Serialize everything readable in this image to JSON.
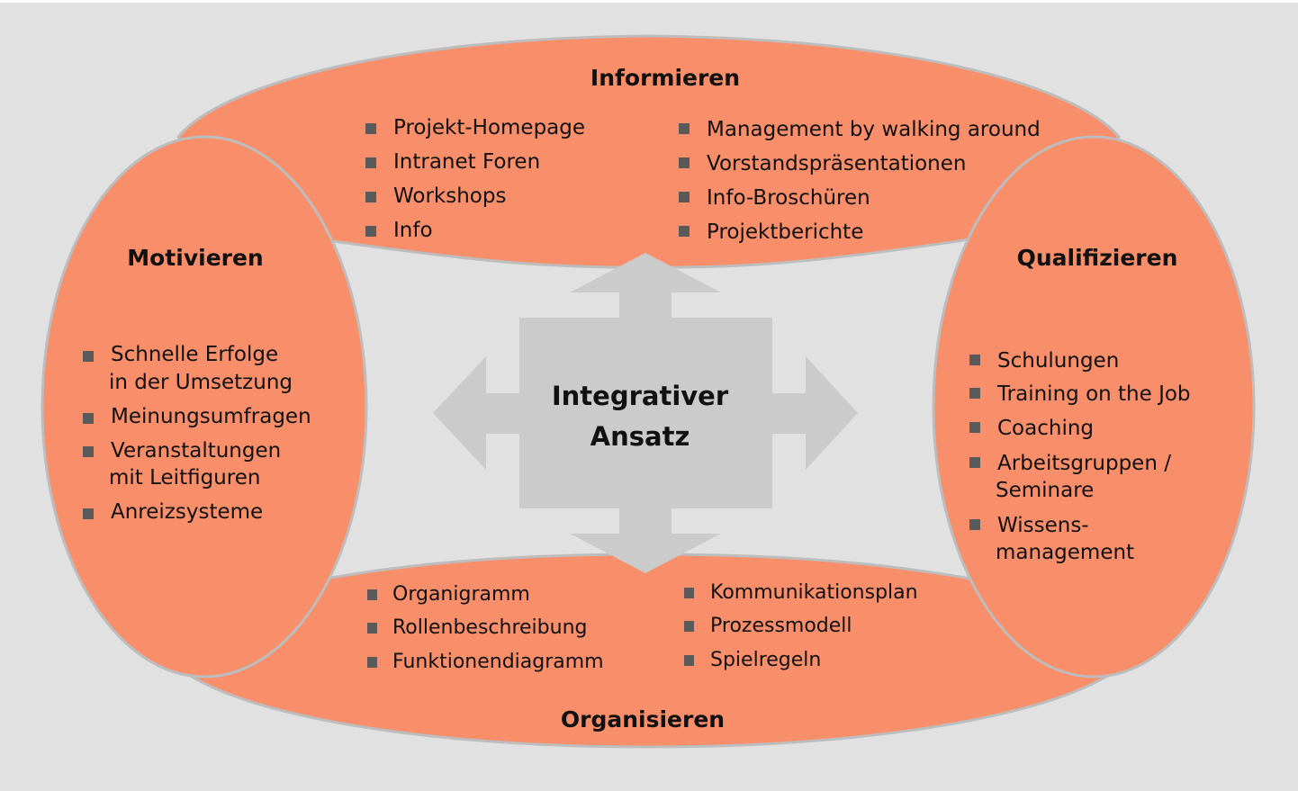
{
  "colors": {
    "background": "#e1e1e1",
    "shape_fill": "#f98e6a",
    "shape_outline": "#bdbdbd",
    "center_fill": "#cbcbcb",
    "bullet": "#5a5a5a",
    "text": "#111111"
  },
  "center": {
    "line1": "Integrativer",
    "line2": "Ansatz"
  },
  "informieren": {
    "title": "Informieren",
    "left_items": [
      "Projekt-Homepage",
      "Intranet Foren",
      "Workshops",
      "Info"
    ],
    "right_items": [
      "Management by walking around",
      "Vorstandspräsentationen",
      "Info-Broschüren",
      "Projektberichte"
    ]
  },
  "motivieren": {
    "title": "Motivieren",
    "items": [
      {
        "lines": [
          "Schnelle Erfolge",
          "in der Umsetzung"
        ]
      },
      {
        "lines": [
          "Meinungsumfragen"
        ]
      },
      {
        "lines": [
          "Veranstaltungen",
          "mit Leitfiguren"
        ]
      },
      {
        "lines": [
          "Anreizsysteme"
        ]
      }
    ]
  },
  "qualifizieren": {
    "title": "Qualifizieren",
    "items": [
      {
        "lines": [
          "Schulungen"
        ]
      },
      {
        "lines": [
          "Training on the Job"
        ]
      },
      {
        "lines": [
          "Coaching"
        ]
      },
      {
        "lines": [
          "Arbeitsgruppen /",
          "Seminare"
        ]
      },
      {
        "lines": [
          "Wissens-",
          "management"
        ]
      }
    ]
  },
  "organisieren": {
    "title": "Organisieren",
    "left_items": [
      "Organigramm",
      "Rollenbeschreibung",
      "Funktionendiagramm"
    ],
    "right_items": [
      "Kommunikationsplan",
      "Prozessmodell",
      "Spielregeln"
    ]
  }
}
